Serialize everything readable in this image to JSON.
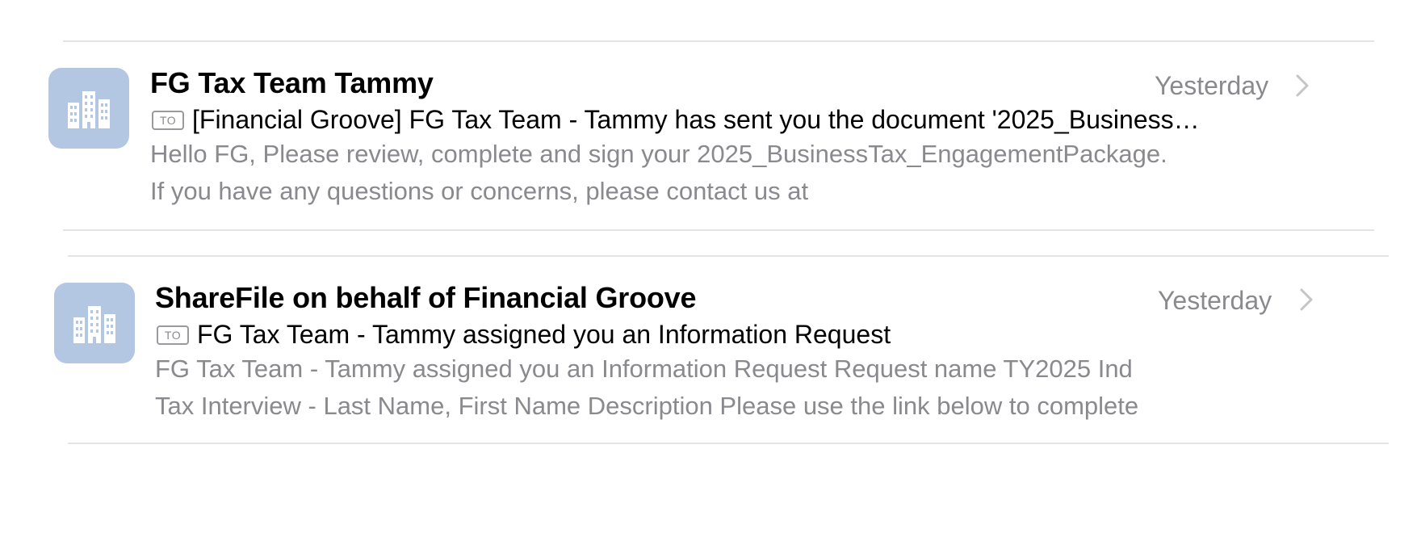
{
  "messages": [
    {
      "sender": "FG Tax Team Tammy",
      "date": "Yesterday",
      "to_badge": "TO",
      "subject": "[Financial Groove] FG Tax Team - Tammy has sent you the document '2025_Business…",
      "preview_line1": "Hello FG, Please review, complete and sign your 2025_BusinessTax_EngagementPackage.",
      "preview_line2": "If you have any questions or concerns, please contact us at",
      "avatar_icon": "building-icon"
    },
    {
      "sender": "ShareFile on behalf of Financial Groove",
      "date": "Yesterday",
      "to_badge": "TO",
      "subject": "FG Tax Team - Tammy assigned you an Information Request",
      "preview_line1": "FG Tax Team - Tammy assigned you an Information Request Request name TY2025 Ind",
      "preview_line2": "Tax Interview - Last Name, First Name Description Please use the link below to complete",
      "avatar_icon": "building-icon"
    }
  ],
  "colors": {
    "avatar_bg": "#b3c6e2",
    "secondary_text": "#8a8a8e",
    "divider": "#e4e4e6"
  }
}
